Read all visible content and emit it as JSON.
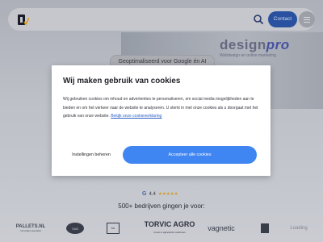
{
  "header": {
    "contact_label": "Contact"
  },
  "hero": {
    "pill_text": "Geoptimaliseerd voor Google én AI",
    "brand_main": "design",
    "brand_accent": "pro",
    "brand_tagline": "Webdesign en online marketing"
  },
  "cookie_modal": {
    "title": "Wij maken gebruik van cookies",
    "body": "Wij gebruiken cookies om inhoud en advertenties te personaliseren, om social media mogelijkheden aan te bieden en om het verkeer naar de website te analyseren. U stemt in met onze cookies als u doorgaat met het gebruik van onze website.",
    "link_text": "Bekijk onze cookieverklaring",
    "settings_label": "Instellingen beheren",
    "accept_label": "Accepteer alle cookies"
  },
  "rating": {
    "score": "4.4",
    "stars": "★★★★★"
  },
  "companies": {
    "heading": "500+ bedrijven gingen je voor:",
    "pallets_name": "PALLETS.NL",
    "pallets_tagline": "Uw pallet specialist",
    "badge_name": "SAB",
    "build_name": "BM",
    "torvic_name": "TORVIC AGRO",
    "torvic_tagline": "Groot in agrarische machines",
    "vagnetic_name": "vagnetic",
    "faded_name": "Loading"
  },
  "colors": {
    "primary_button": "#3f86f2",
    "contact_button": "#2b55a8",
    "link": "#2c5fc4"
  }
}
